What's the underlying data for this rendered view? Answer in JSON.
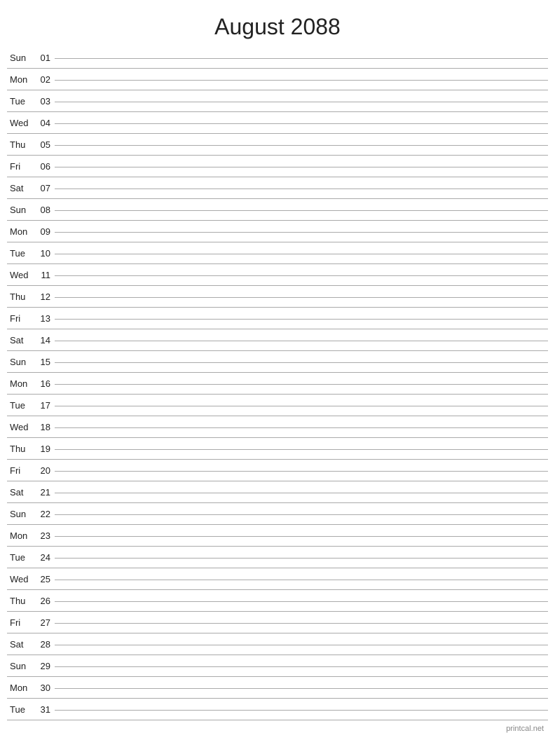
{
  "title": "August 2088",
  "footer": "printcal.net",
  "days": [
    {
      "name": "Sun",
      "num": "01"
    },
    {
      "name": "Mon",
      "num": "02"
    },
    {
      "name": "Tue",
      "num": "03"
    },
    {
      "name": "Wed",
      "num": "04"
    },
    {
      "name": "Thu",
      "num": "05"
    },
    {
      "name": "Fri",
      "num": "06"
    },
    {
      "name": "Sat",
      "num": "07"
    },
    {
      "name": "Sun",
      "num": "08"
    },
    {
      "name": "Mon",
      "num": "09"
    },
    {
      "name": "Tue",
      "num": "10"
    },
    {
      "name": "Wed",
      "num": "11"
    },
    {
      "name": "Thu",
      "num": "12"
    },
    {
      "name": "Fri",
      "num": "13"
    },
    {
      "name": "Sat",
      "num": "14"
    },
    {
      "name": "Sun",
      "num": "15"
    },
    {
      "name": "Mon",
      "num": "16"
    },
    {
      "name": "Tue",
      "num": "17"
    },
    {
      "name": "Wed",
      "num": "18"
    },
    {
      "name": "Thu",
      "num": "19"
    },
    {
      "name": "Fri",
      "num": "20"
    },
    {
      "name": "Sat",
      "num": "21"
    },
    {
      "name": "Sun",
      "num": "22"
    },
    {
      "name": "Mon",
      "num": "23"
    },
    {
      "name": "Tue",
      "num": "24"
    },
    {
      "name": "Wed",
      "num": "25"
    },
    {
      "name": "Thu",
      "num": "26"
    },
    {
      "name": "Fri",
      "num": "27"
    },
    {
      "name": "Sat",
      "num": "28"
    },
    {
      "name": "Sun",
      "num": "29"
    },
    {
      "name": "Mon",
      "num": "30"
    },
    {
      "name": "Tue",
      "num": "31"
    }
  ]
}
